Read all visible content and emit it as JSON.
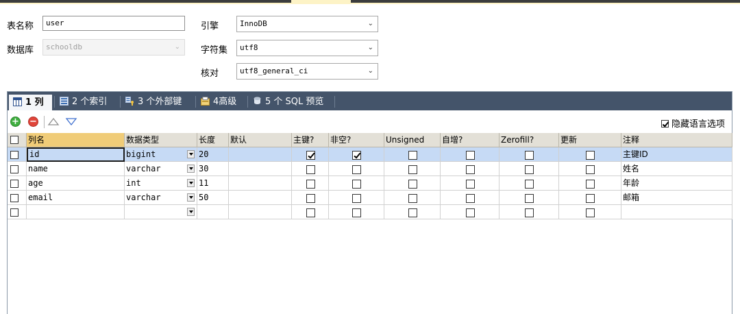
{
  "form": {
    "table_name_label": "表名称",
    "table_name_value": "user",
    "database_label": "数据库",
    "database_value": "schooldb",
    "engine_label": "引擎",
    "engine_value": "InnoDB",
    "charset_label": "字符集",
    "charset_value": "utf8",
    "collation_label": "核对",
    "collation_value": "utf8_general_ci"
  },
  "tabs": [
    {
      "label": "1 列",
      "icon": "columns-icon",
      "active": true
    },
    {
      "label": "2 个索引",
      "icon": "index-icon",
      "active": false
    },
    {
      "label": "3 个外部键",
      "icon": "foreign-key-icon",
      "active": false
    },
    {
      "label": "4高级",
      "icon": "advanced-icon",
      "active": false
    },
    {
      "label": "5 个 SQL 预览",
      "icon": "sql-preview-icon",
      "active": false
    }
  ],
  "toolbar": {
    "hide_language_options_label": "隐藏语言选项",
    "hide_language_options_checked": true
  },
  "columns": {
    "headers": [
      "列名",
      "数据类型",
      "长度",
      "默认",
      "主键?",
      "非空?",
      "Unsigned",
      "自增?",
      "Zerofill?",
      "更新",
      "注释"
    ]
  },
  "rows": [
    {
      "name": "id",
      "type": "bigint",
      "length": "20",
      "default": "",
      "pk": true,
      "not_null": true,
      "unsigned": false,
      "auto_inc": false,
      "zerofill": false,
      "update": false,
      "comment": "主键ID"
    },
    {
      "name": "name",
      "type": "varchar",
      "length": "30",
      "default": "",
      "pk": false,
      "not_null": false,
      "unsigned": false,
      "auto_inc": false,
      "zerofill": false,
      "update": false,
      "comment": "姓名"
    },
    {
      "name": "age",
      "type": "int",
      "length": "11",
      "default": "",
      "pk": false,
      "not_null": false,
      "unsigned": false,
      "auto_inc": false,
      "zerofill": false,
      "update": false,
      "comment": "年龄"
    },
    {
      "name": "email",
      "type": "varchar",
      "length": "50",
      "default": "",
      "pk": false,
      "not_null": false,
      "unsigned": false,
      "auto_inc": false,
      "zerofill": false,
      "update": false,
      "comment": "邮箱"
    },
    {
      "name": "",
      "type": "",
      "length": "",
      "default": "",
      "pk": false,
      "not_null": false,
      "unsigned": false,
      "auto_inc": false,
      "zerofill": false,
      "update": false,
      "comment": ""
    }
  ],
  "colors": {
    "tabbar_bg": "#44546a",
    "header_bg": "#e3e0d7",
    "header_first_bg": "#f0cc78",
    "selected_row_bg": "#c6daf5",
    "top_strip_bg": "#fdf3c6"
  }
}
